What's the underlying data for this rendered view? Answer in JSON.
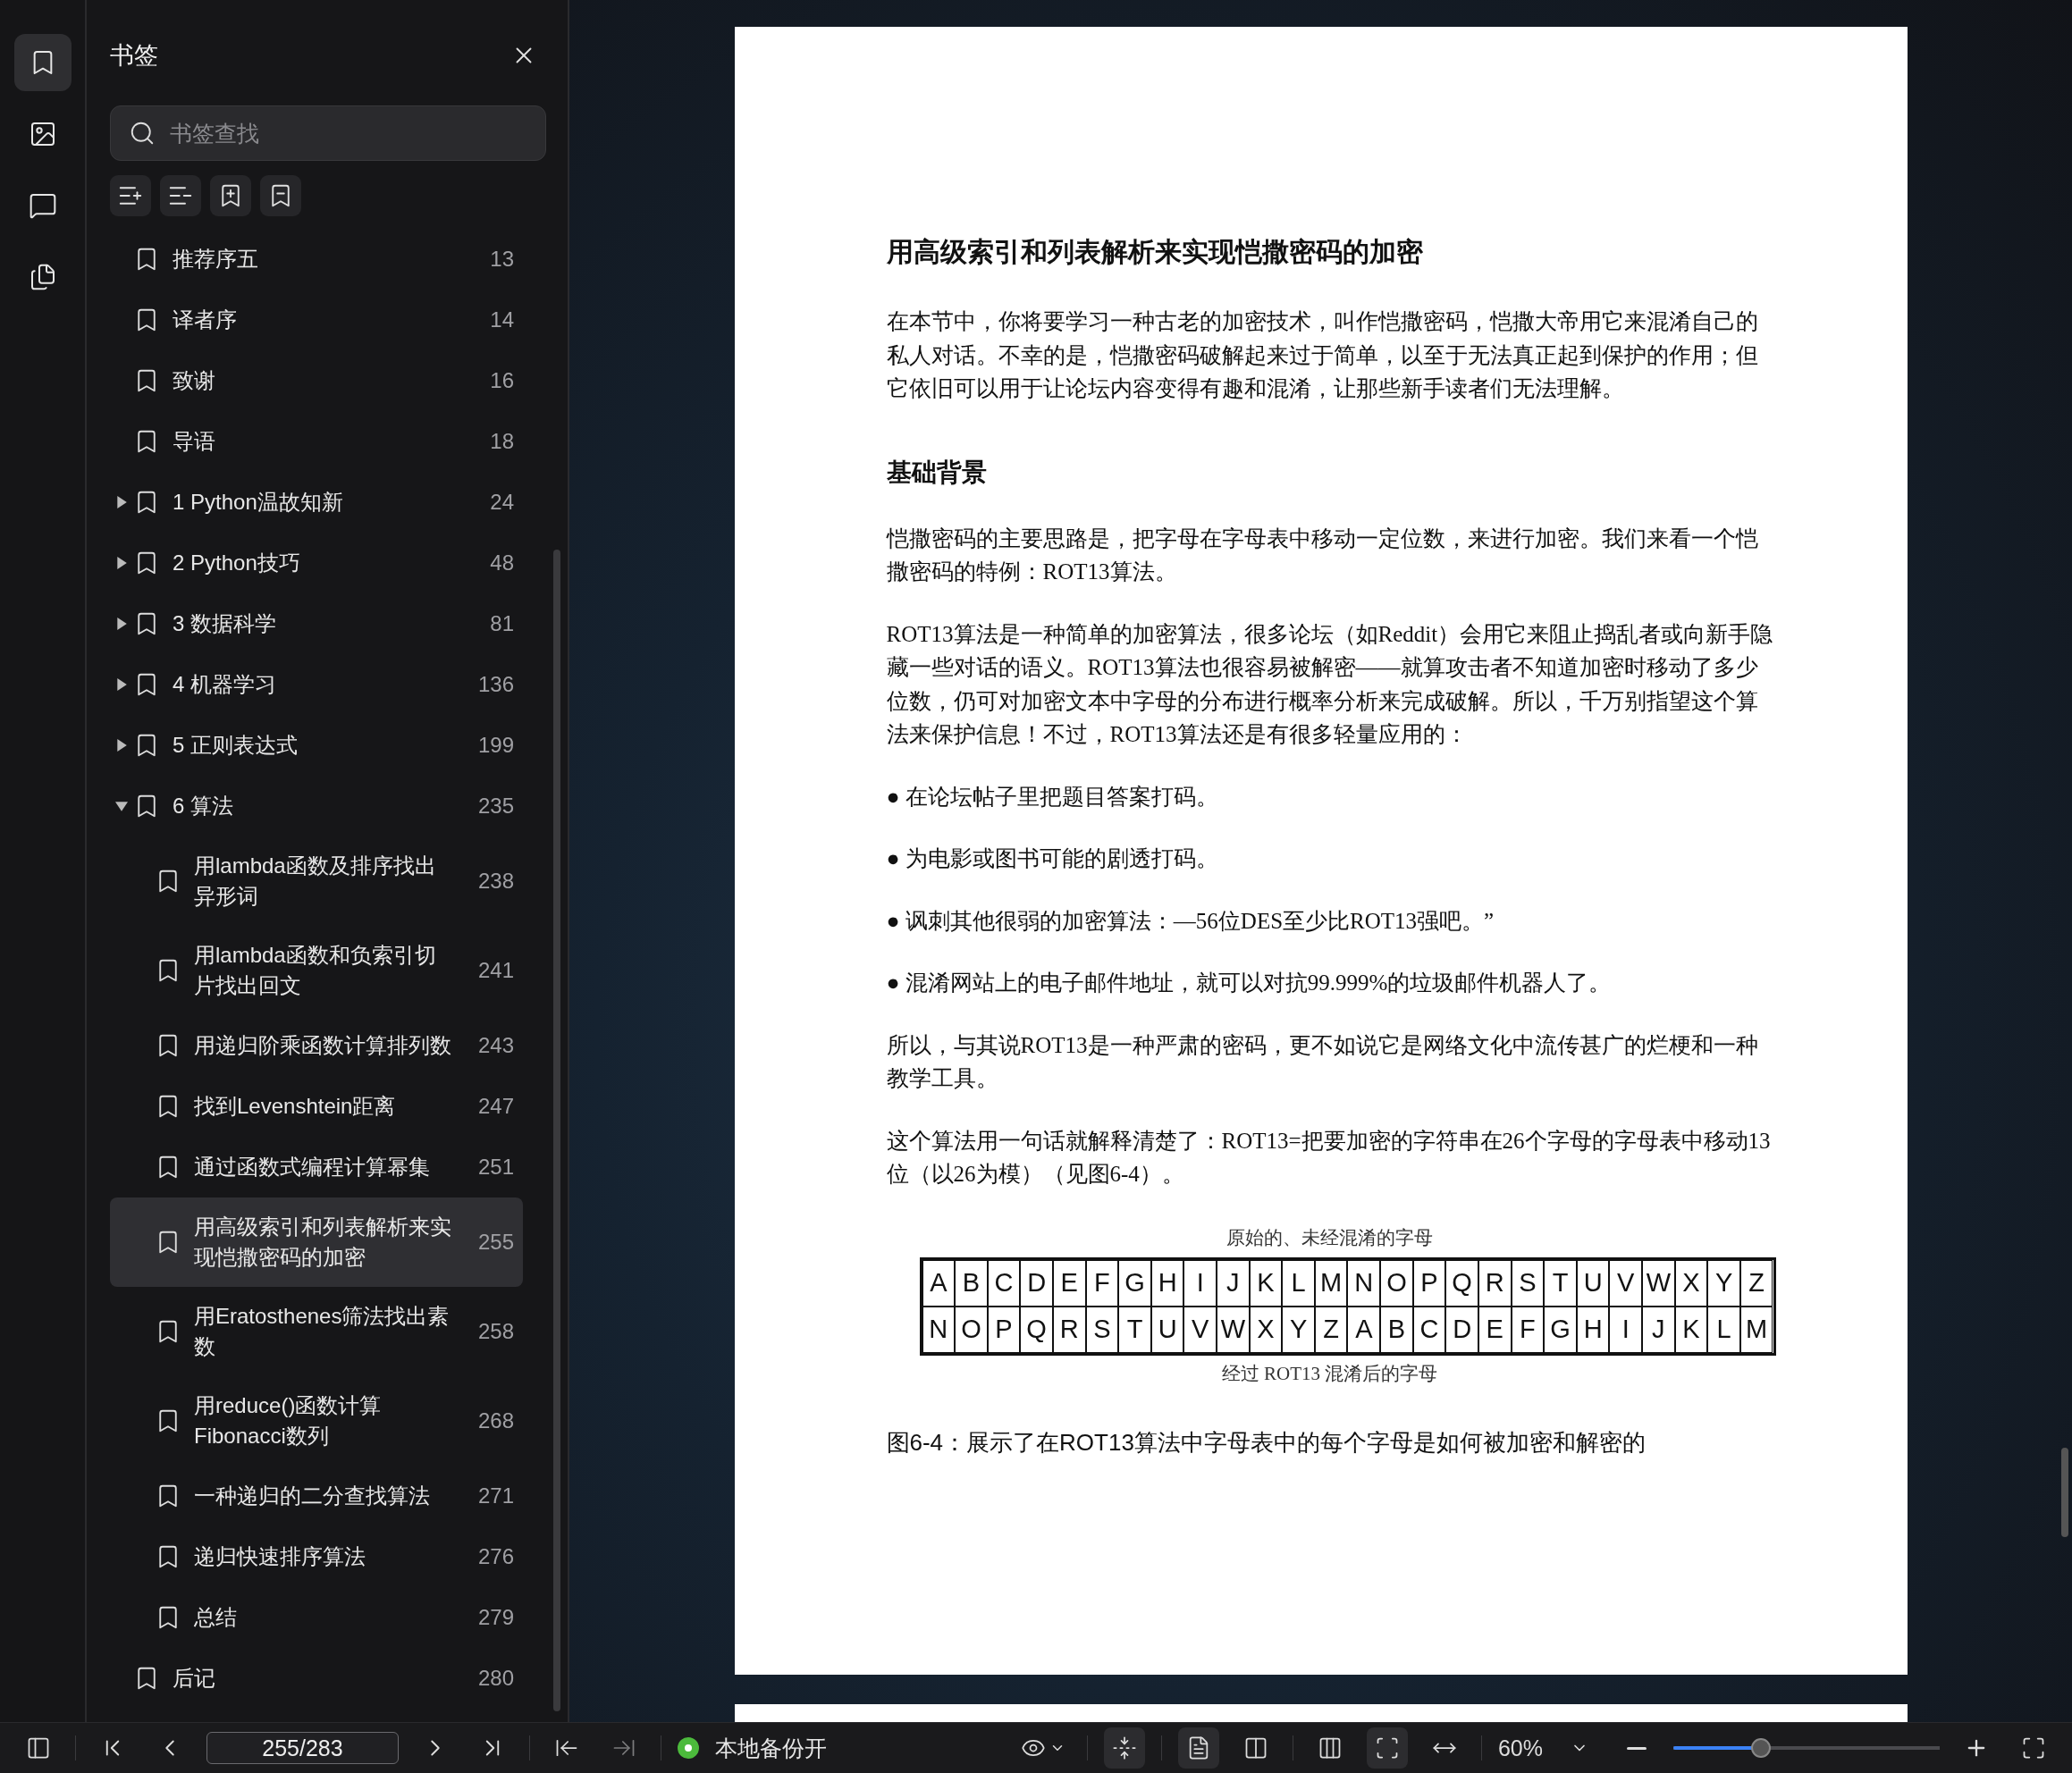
{
  "rail": [
    {
      "selected": true
    },
    {
      "selected": false
    },
    {
      "selected": false
    },
    {
      "selected": false
    }
  ],
  "sidebar": {
    "title": "书签",
    "search": {
      "placeholder": "书签查找"
    },
    "bookmarks": [
      {
        "label": "推荐序五",
        "page": "13",
        "kind": "leaf",
        "selected": false
      },
      {
        "label": "译者序",
        "page": "14",
        "kind": "leaf",
        "selected": false
      },
      {
        "label": "致谢",
        "page": "16",
        "kind": "leaf",
        "selected": false
      },
      {
        "label": "导语",
        "page": "18",
        "kind": "leaf",
        "selected": false
      },
      {
        "label": "1 Python温故知新",
        "page": "24",
        "kind": "group",
        "expanded": false,
        "selected": false
      },
      {
        "label": "2 Python技巧",
        "page": "48",
        "kind": "group",
        "expanded": false,
        "selected": false
      },
      {
        "label": "3 数据科学",
        "page": "81",
        "kind": "group",
        "expanded": false,
        "selected": false
      },
      {
        "label": "4 机器学习",
        "page": "136",
        "kind": "group",
        "expanded": false,
        "selected": false
      },
      {
        "label": "5 正则表达式",
        "page": "199",
        "kind": "group",
        "expanded": false,
        "selected": false
      },
      {
        "label": "6 算法",
        "page": "235",
        "kind": "group",
        "expanded": true,
        "selected": false,
        "children": [
          {
            "label": "用lambda函数及排序找出异形词",
            "page": "238",
            "selected": false
          },
          {
            "label": "用lambda函数和负索引切片找出回文",
            "page": "241",
            "selected": false
          },
          {
            "label": "用递归阶乘函数计算排列数",
            "page": "243",
            "selected": false
          },
          {
            "label": "找到Levenshtein距离",
            "page": "247",
            "selected": false
          },
          {
            "label": "通过函数式编程计算幂集",
            "page": "251",
            "selected": false
          },
          {
            "label": "用高级索引和列表解析来实现恺撒密码的加密",
            "page": "255",
            "selected": true
          },
          {
            "label": "用Eratosthenes筛法找出素数",
            "page": "258",
            "selected": false
          },
          {
            "label": "用reduce()函数计算Fibonacci数列",
            "page": "268",
            "selected": false
          },
          {
            "label": "一种递归的二分查找算法",
            "page": "271",
            "selected": false
          },
          {
            "label": "递归快速排序算法",
            "page": "276",
            "selected": false
          },
          {
            "label": "总结",
            "page": "279",
            "selected": false
          }
        ]
      },
      {
        "label": "后记",
        "page": "280",
        "kind": "leaf",
        "selected": false
      }
    ]
  },
  "document": {
    "blocks": [
      {
        "kind": "title",
        "text": "用高级索引和列表解析来实现恺撒密码的加密"
      },
      {
        "kind": "paragraph",
        "text": "在本节中，你将要学习一种古老的加密技术，叫作恺撒密码，恺撒大帝用它来混淆自己的私人对话。不幸的是，恺撒密码破解起来过于简单，以至于无法真正起到保护的作用；但它依旧可以用于让论坛内容变得有趣和混淆，让那些新手读者们无法理解。"
      },
      {
        "kind": "heading",
        "text": "基础背景"
      },
      {
        "kind": "paragraph",
        "text": "恺撒密码的主要思路是，把字母在字母表中移动一定位数，来进行加密。我们来看一个恺撒密码的特例：ROT13算法。"
      },
      {
        "kind": "paragraph",
        "text": "ROT13算法是一种简单的加密算法，很多论坛（如Reddit）会用它来阻止捣乱者或向新手隐藏一些对话的语义。ROT13算法也很容易被解密——就算攻击者不知道加密时移动了多少位数，仍可对加密文本中字母的分布进行概率分析来完成破解。所以，千万别指望这个算法来保护信息！不过，ROT13算法还是有很多轻量应用的："
      },
      {
        "kind": "paragraph",
        "text": "● 在论坛帖子里把题目答案打码。"
      },
      {
        "kind": "paragraph",
        "text": "● 为电影或图书可能的剧透打码。"
      },
      {
        "kind": "paragraph",
        "text": "● 讽刺其他很弱的加密算法：—56位DES至少比ROT13强吧。”"
      },
      {
        "kind": "paragraph",
        "text": "● 混淆网站上的电子邮件地址，就可以对抗99.999%的垃圾邮件机器人了。"
      },
      {
        "kind": "paragraph",
        "text": "所以，与其说ROT13是一种严肃的密码，更不如说它是网络文化中流传甚广的烂梗和一种教学工具。"
      },
      {
        "kind": "paragraph",
        "text": "这个算法用一句话就解释清楚了：ROT13=把要加密的字符串在26个字母的字母表中移动13位（以26为模）（见图6-4）。"
      }
    ],
    "figure": {
      "top_label": "原始的、未经混淆的字母",
      "row_1": [
        "A",
        "B",
        "C",
        "D",
        "E",
        "F",
        "G",
        "H",
        "I",
        "J",
        "K",
        "L",
        "M",
        "N",
        "O",
        "P",
        "Q",
        "R",
        "S",
        "T",
        "U",
        "V",
        "W",
        "X",
        "Y",
        "Z"
      ],
      "row_2": [
        "N",
        "O",
        "P",
        "Q",
        "R",
        "S",
        "T",
        "U",
        "V",
        "W",
        "X",
        "Y",
        "Z",
        "A",
        "B",
        "C",
        "D",
        "E",
        "F",
        "G",
        "H",
        "I",
        "J",
        "K",
        "L",
        "M"
      ],
      "bottom_label": "经过 ROT13 混淆后的字母",
      "caption": "图6-4：展示了在ROT13算法中字母表中的每个字母是如何被加密和解密的"
    }
  },
  "status_bar": {
    "page_field": "255/283",
    "backup": {
      "label": "本地备份开",
      "on": true
    },
    "view_buttons": [
      {
        "selected": false
      },
      {
        "selected": true
      },
      {
        "selected": true
      },
      {
        "selected": false
      },
      {
        "selected": false
      },
      {
        "selected": true
      },
      {
        "selected": false
      }
    ],
    "zoom": {
      "value": "60%",
      "level": 0.33
    }
  }
}
